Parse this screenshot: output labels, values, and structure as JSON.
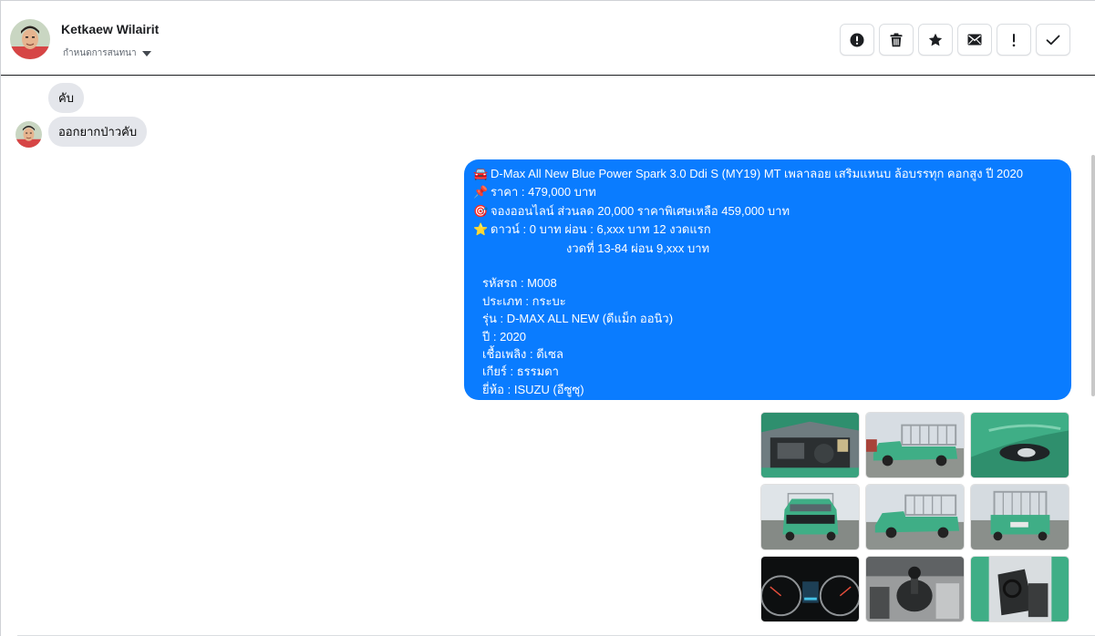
{
  "header": {
    "contact_name": "Ketkaew Wilairit",
    "assign_label": "กำหนดการสนทนา",
    "actions": [
      {
        "icon": "alert-circle-icon",
        "name": "spam-button"
      },
      {
        "icon": "trash-icon",
        "name": "delete-button"
      },
      {
        "icon": "star-icon",
        "name": "star-button"
      },
      {
        "icon": "envelope-icon",
        "name": "mark-unread-button"
      },
      {
        "icon": "exclamation-icon",
        "name": "follow-up-button"
      },
      {
        "icon": "check-icon",
        "name": "mark-done-button"
      }
    ]
  },
  "thread": {
    "incoming": [
      {
        "text": "คับ"
      },
      {
        "text": "ออกยากป่าวคับ"
      }
    ],
    "outgoing": {
      "lines": [
        {
          "emoji": "🚘",
          "text": "D-Max All New Blue Power Spark 3.0 Ddi S (MY19) MT เพลาลอย เสริมแหนบ ล้อบรรทุก คอกสูง  ปี 2020"
        },
        {
          "emoji": "📌",
          "text": "ราคา : 479,000 บาท"
        },
        {
          "emoji": "🎯",
          "text": "จองออนไลน์ ส่วนลด 20,000 ราคาพิเศษเหลือ 459,000 บาท"
        },
        {
          "emoji": "⭐",
          "text": "ดาวน์ : 0 บาท ผ่อน : 6,xxx บาท 12 งวดแรก"
        },
        {
          "emoji": "",
          "text": "งวดที่ 13-84 ผ่อน 9,xxx บาท"
        },
        {
          "emoji": "",
          "text": ""
        },
        {
          "emoji": "",
          "text": "รหัสรถ : M008"
        },
        {
          "emoji": "",
          "text": "ประเภท : กระบะ"
        },
        {
          "emoji": "",
          "text": "รุ่น : D-MAX ALL NEW (ดีแม็ก ออนิว)"
        },
        {
          "emoji": "",
          "text": "ปี : 2020"
        },
        {
          "emoji": "",
          "text": "เชื้อเพลิง : ดีเซล"
        },
        {
          "emoji": "",
          "text": "เกียร์ : ธรรมดา"
        },
        {
          "emoji": "",
          "text": "ยี่ห้อ : ISUZU (อีซูซุ)"
        }
      ],
      "bubble_color": "#0a7cff"
    },
    "photos": [
      {
        "subject": "engine-bay"
      },
      {
        "subject": "truck-side-cage"
      },
      {
        "subject": "fog-light-closeup"
      },
      {
        "subject": "truck-front"
      },
      {
        "subject": "truck-side"
      },
      {
        "subject": "truck-rear"
      },
      {
        "subject": "dashboard-gauges"
      },
      {
        "subject": "gear-shifter"
      },
      {
        "subject": "driver-door-interior"
      }
    ]
  },
  "colors": {
    "accent": "#0a7cff",
    "incoming_bubble": "#e4e6eb",
    "truck_green": "#3fae86"
  }
}
